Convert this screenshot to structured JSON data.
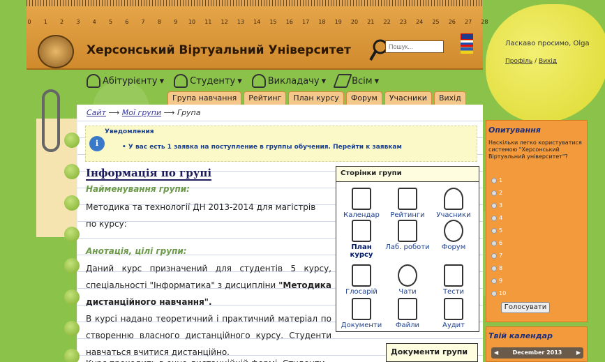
{
  "header": {
    "site_title": "Херсонський Віртуальний Університет",
    "search_placeholder": "Пошук...",
    "ruler_numbers": [
      "0",
      "1",
      "2",
      "3",
      "4",
      "5",
      "6",
      "7",
      "8",
      "9",
      "10",
      "11",
      "12",
      "13",
      "14",
      "15",
      "16",
      "17",
      "18",
      "19",
      "20",
      "21",
      "22",
      "23",
      "24",
      "25",
      "26",
      "27",
      "28"
    ]
  },
  "user": {
    "welcome": "Ласкаво просимо, Olga",
    "profile": "Профіль",
    "separator": " / ",
    "logout": "Вихід"
  },
  "nav": {
    "items": [
      {
        "label": "Абітурієнту",
        "icon": "applicant-icon"
      },
      {
        "label": "Студенту",
        "icon": "student-icon"
      },
      {
        "label": "Викладачу",
        "icon": "teacher-icon"
      },
      {
        "label": "Всім",
        "icon": "everyone-icon"
      }
    ]
  },
  "tabs": [
    "Група навчання",
    "Рейтинг",
    "План курсу",
    "Форум",
    "Учасники",
    "Вихід"
  ],
  "breadcrumb": {
    "site": "Сайт",
    "groups": "Мої групи",
    "current": "Група"
  },
  "notice": {
    "title": "Уведомления",
    "text": "У вас есть 1 заявка на поступление в группы обучения. Перейти к заявкам"
  },
  "group": {
    "heading": "Інформація по групі",
    "name_label": "Найменування групи:",
    "name": "Методика та технології ДН 2013-2014 для магістрів по курсу:",
    "annotation_label": "Анотація, цілі групи:",
    "annotation_p1_a": "Даний курс призначений для студентів 5 курсу, спеціальності \"Інформатика\" з дисципліни ",
    "annotation_p1_b": "\"Методика дистанційного навчання\".",
    "annotation_p2": "В курсі надано теоретичний і практичний матеріал по створенню власного дистанційного курсу. Студенти навчаться вчитися дистанційно.",
    "annotation_p3": "Курс проходить в очно-дистанційній формі. Студенти"
  },
  "group_pages": {
    "title": "Сторінки групи",
    "items": [
      "Календар",
      "Рейтинги",
      "Учасники",
      "План курсу",
      "Лаб. роботи",
      "Форум",
      "Глосарій",
      "Чати",
      "Тести",
      "Документи",
      "Файли",
      "Аудит"
    ]
  },
  "docs": {
    "title": "Документи групи"
  },
  "poll": {
    "title": "Опитування",
    "question": "Наскільки легко користуватися системою \"Херсонський Віртуальний університет\"?",
    "options": [
      "1",
      "2",
      "3",
      "4",
      "5",
      "6",
      "7",
      "8",
      "9",
      "10"
    ],
    "vote_label": "Голосувати"
  },
  "calendar": {
    "title": "Твій календар",
    "month": "December 2013",
    "prev": "◀",
    "next": "▶"
  }
}
